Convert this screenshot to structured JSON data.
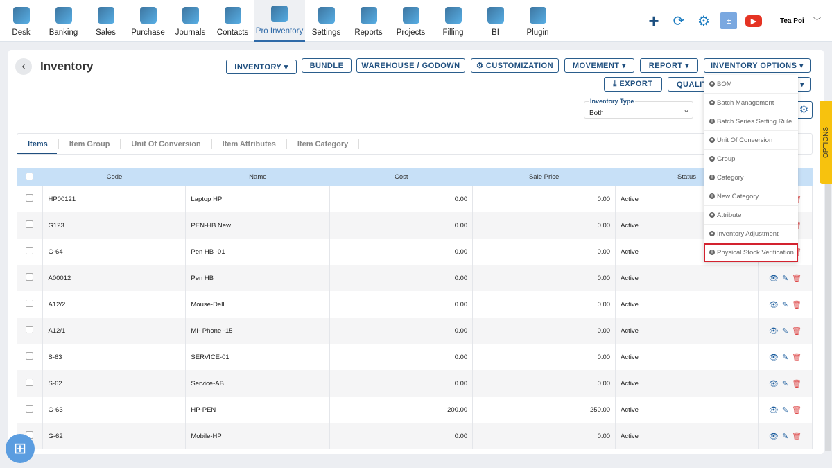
{
  "nav": {
    "items": [
      {
        "label": "Desk",
        "icon": "desk-icon"
      },
      {
        "label": "Banking",
        "icon": "bank-icon"
      },
      {
        "label": "Sales",
        "icon": "sales-icon"
      },
      {
        "label": "Purchase",
        "icon": "purchase-icon"
      },
      {
        "label": "Journals",
        "icon": "journals-icon"
      },
      {
        "label": "Contacts",
        "icon": "contacts-icon"
      },
      {
        "label": "Pro Inventory",
        "icon": "inventory-icon",
        "active": true
      },
      {
        "label": "Settings",
        "icon": "settings-icon"
      },
      {
        "label": "Reports",
        "icon": "reports-icon"
      },
      {
        "label": "Projects",
        "icon": "projects-icon"
      },
      {
        "label": "Filling",
        "icon": "filling-icon"
      },
      {
        "label": "BI",
        "icon": "bi-icon"
      },
      {
        "label": "Plugin",
        "icon": "plugin-icon"
      }
    ],
    "company": "Tea Poi"
  },
  "page": {
    "title": "Inventory"
  },
  "buttons": {
    "inventory": "INVENTORY ▾",
    "bundle": "BUNDLE",
    "warehouse": "WAREHOUSE / GODOWN",
    "customization": "⚙ CUSTOMIZATION",
    "movement": "MOVEMENT ▾",
    "report": "REPORT ▾",
    "options": "INVENTORY OPTIONS ▾",
    "export": "⤓ EXPORT",
    "quality": "QUALIT"
  },
  "filter": {
    "label": "Inventory Type",
    "value": "Both"
  },
  "tabs": [
    "Items",
    "Item Group",
    "Unit Of Conversion",
    "Item Attributes",
    "Item Category"
  ],
  "table": {
    "headers": [
      "Code",
      "Name",
      "Cost",
      "Sale Price",
      "Status"
    ],
    "rows": [
      [
        "HP00121",
        "Laptop HP",
        "0.00",
        "0.00",
        "Active"
      ],
      [
        "G123",
        "PEN-HB New",
        "0.00",
        "0.00",
        "Active"
      ],
      [
        "G-64",
        "Pen HB -01",
        "0.00",
        "0.00",
        "Active"
      ],
      [
        "A00012",
        "Pen HB",
        "0.00",
        "0.00",
        "Active"
      ],
      [
        "A12/2",
        "Mouse-Dell",
        "0.00",
        "0.00",
        "Active"
      ],
      [
        "A12/1",
        "MI- Phone -15",
        "0.00",
        "0.00",
        "Active"
      ],
      [
        "S-63",
        "SERVICE-01",
        "0.00",
        "0.00",
        "Active"
      ],
      [
        "S-62",
        "Service-AB",
        "0.00",
        "0.00",
        "Active"
      ],
      [
        "G-63",
        "HP-PEN",
        "200.00",
        "250.00",
        "Active"
      ],
      [
        "G-62",
        "Mobile-HP",
        "0.00",
        "0.00",
        "Active"
      ]
    ]
  },
  "dropdown": [
    "BOM",
    "Batch Management",
    "Batch Series Setting Rule",
    "Unit Of Conversion",
    "Group",
    "Category",
    "New Category",
    "Attribute",
    "Inventory Adjustment",
    "Physical Stock Verification"
  ],
  "highlighted": "Physical Stock Verification",
  "options_tab": "OPTIONS"
}
